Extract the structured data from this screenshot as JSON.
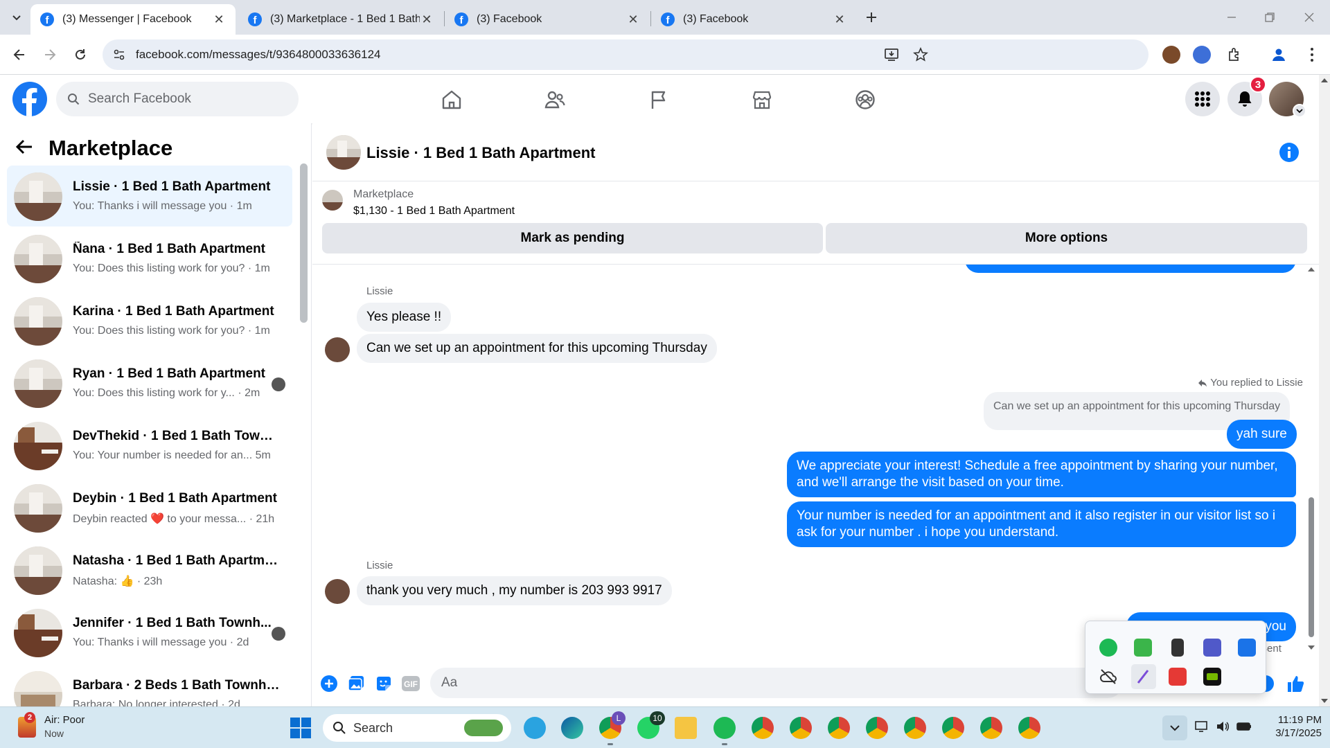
{
  "browser": {
    "tabs": [
      {
        "title": "(3) Messenger | Facebook",
        "active": true
      },
      {
        "title": "(3) Marketplace - 1 Bed 1 Bath",
        "active": false
      },
      {
        "title": "(3) Facebook",
        "active": false
      },
      {
        "title": "(3) Facebook",
        "active": false
      }
    ],
    "url": "facebook.com/messages/t/9364800033636124"
  },
  "header": {
    "search_placeholder": "Search Facebook",
    "notification_count": "3"
  },
  "sidebar": {
    "title": "Marketplace",
    "conversations": [
      {
        "name": "Lissie · 1 Bed 1 Bath Apartment",
        "preview": "You: Thanks i will message you · 1m",
        "selected": true
      },
      {
        "name": "Ñana · 1 Bed 1 Bath Apartment",
        "preview": "You: Does this listing work for you? · 1m"
      },
      {
        "name": "Karina · 1 Bed 1 Bath Apartment",
        "preview": "You: Does this listing work for you? · 1m"
      },
      {
        "name": "Ryan · 1 Bed 1 Bath Apartment",
        "preview": "You: Does this listing work for y... · 2m"
      },
      {
        "name": "DevThekid · 1 Bed 1 Bath Townh...",
        "preview": "You: Your number is needed for an... 5m"
      },
      {
        "name": "Deybin · 1 Bed 1 Bath Apartment",
        "preview": "Deybin reacted ❤️ to your messa... · 21h"
      },
      {
        "name": "Natasha · 1 Bed 1 Bath Apartment",
        "preview": "Natasha: 👍 · 23h"
      },
      {
        "name": "Jennifer · 1 Bed 1 Bath Townh...",
        "preview": "You: Thanks i will message you · 2d"
      },
      {
        "name": "Barbara · 2 Beds 1 Bath Townho...",
        "preview": "Barbara: No longer interested · 2d"
      }
    ]
  },
  "chat": {
    "title": "Lissie · 1 Bed 1 Bath Apartment",
    "listing_label": "Marketplace",
    "listing_title": "$1,130 - 1 Bed 1 Bath Apartment",
    "mark_pending": "Mark as pending",
    "more_options": "More options",
    "sender_name_1": "Lissie",
    "msg_in_1": "Yes please !!",
    "msg_in_2": "Can we set up an appointment for this upcoming Thursday",
    "replied_label": "You replied to Lissie",
    "quoted": "Can we set up an appointment for this upcoming Thursday",
    "msg_out_1": "yah sure",
    "msg_out_2": "We appreciate your interest! Schedule a free appointment by sharing your number, and we'll arrange the visit based on your time.",
    "msg_out_3": "Your number is needed for an appointment  and it also register in our visitor list so i ask for your number . i hope you understand.",
    "sender_name_2": "Lissie",
    "msg_in_3": "thank you very much , my number is 203 993 9917",
    "msg_out_4": "you",
    "status": "Sent",
    "composer_placeholder": "Aa"
  },
  "taskbar": {
    "weather_title": "Air: Poor",
    "weather_sub": "Now",
    "weather_badge": "2",
    "search_label": "Search",
    "chrome_badge": "L",
    "whatsapp_badge": "10",
    "time": "11:19 PM",
    "date": "3/17/2025"
  },
  "colors": {
    "fb_blue": "#1877f2",
    "messenger_blue": "#0a7cff",
    "notification_red": "#e41e3f"
  }
}
